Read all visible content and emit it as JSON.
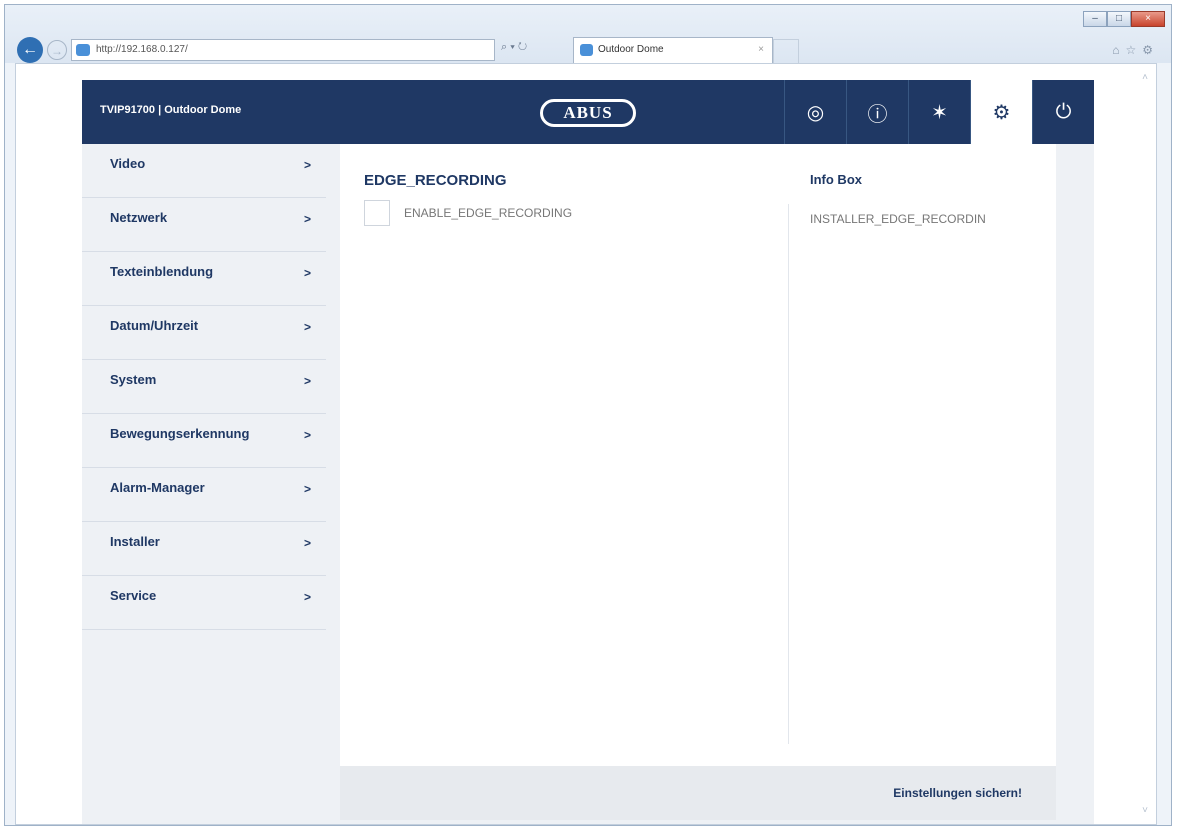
{
  "browser": {
    "url": "http://192.168.0.127/",
    "addr_tools": "⌕ ▾ ↻",
    "tab_title": "Outdoor Dome",
    "tab_close": "×",
    "back": "←",
    "forward": "→",
    "ie_tools": "⌂☆⚙",
    "window_controls": [
      "–",
      "□",
      "×"
    ]
  },
  "header": {
    "title": "TVIP91700 | Outdoor Dome",
    "logo": "ABUS",
    "icons": [
      {
        "name": "live-view-icon",
        "glyph": "◎"
      },
      {
        "name": "info-icon",
        "glyph": "ⓘ"
      },
      {
        "name": "wizard-icon",
        "glyph": "✶"
      },
      {
        "name": "settings-icon",
        "glyph": "⚙"
      },
      {
        "name": "power-icon",
        "glyph": "⏻"
      }
    ]
  },
  "sidebar": {
    "chevron": ">",
    "items": [
      {
        "label": "Video"
      },
      {
        "label": "Netzwerk"
      },
      {
        "label": "Texteinblendung"
      },
      {
        "label": "Datum/Uhrzeit"
      },
      {
        "label": "System"
      },
      {
        "label": "Bewegungserkennung"
      },
      {
        "label": "Alarm-Manager"
      },
      {
        "label": "Installer"
      },
      {
        "label": "Service"
      }
    ]
  },
  "main": {
    "section_title": "EDGE_RECORDING",
    "checkbox_label": "ENABLE_EDGE_RECORDING",
    "info_title": "Info Box",
    "info_text": "INSTALLER_EDGE_RECORDIN",
    "save_label": "Einstellungen sichern!"
  },
  "scroll": {
    "up": "˄",
    "down": "˅"
  },
  "colors": {
    "header": "#1f3864",
    "sidebar": "#eef1f5",
    "accent": "#1f3864"
  }
}
